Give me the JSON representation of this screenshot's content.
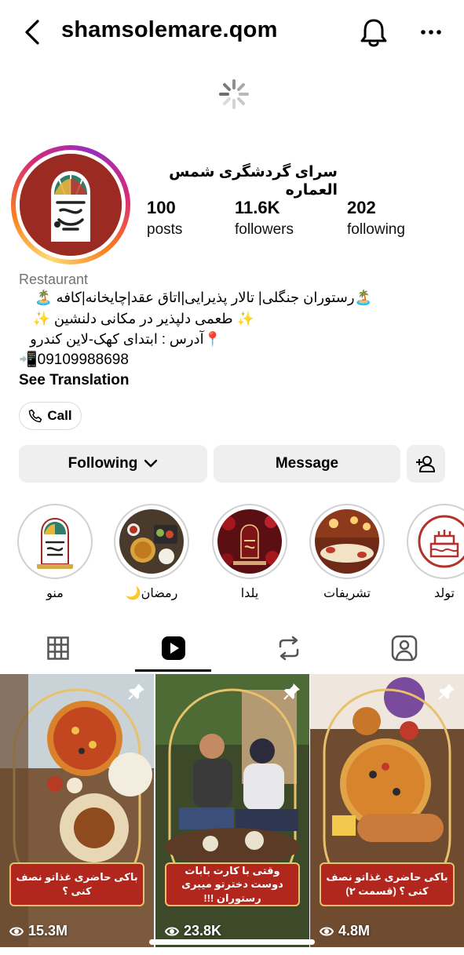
{
  "header": {
    "username": "shamsolemare.qom"
  },
  "profile": {
    "display_name": "سرای گردشگری شمس العماره",
    "stats": [
      {
        "value": "100",
        "label": "posts"
      },
      {
        "value": "11.6K",
        "label": "followers"
      },
      {
        "value": "202",
        "label": "following"
      }
    ],
    "category": "Restaurant",
    "bio_lines": [
      "🏝️رستوران جنگلی| تالار پذیرایی|اتاق عقد|چایخانه|کافه 🏝️",
      "✨ طعمی دلپذیر در مکانی دلنشین ✨",
      "📍آدرس : ابتدای کهک-لاین کندرو"
    ],
    "phone": "📲09109988698",
    "see_translation": "See Translation",
    "call_label": "Call"
  },
  "actions": {
    "following_label": "Following",
    "message_label": "Message"
  },
  "highlights": [
    {
      "label": "منو"
    },
    {
      "label": "رمضان🌙"
    },
    {
      "label": "یلدا"
    },
    {
      "label": "تشریفات"
    },
    {
      "label": "تولد"
    }
  ],
  "tabs": [
    "grid-icon",
    "reels-icon",
    "reposts-icon",
    "tagged-icon"
  ],
  "grid": [
    {
      "caption": "باکی حاضری غذاتو نصف کنی ؟",
      "views": "15.3M"
    },
    {
      "caption": "وقتی با کارت بابات دوست دخترتو میبری رستوران !!!",
      "views": "23.8K"
    },
    {
      "caption": "باکی حاضری غذاتو نصف کنی ؟ (قسمت ۲)",
      "views": "4.8M"
    }
  ],
  "colors": {
    "brand_red": "#9b2a22",
    "button_bg": "#efefef",
    "muted": "#737373"
  }
}
